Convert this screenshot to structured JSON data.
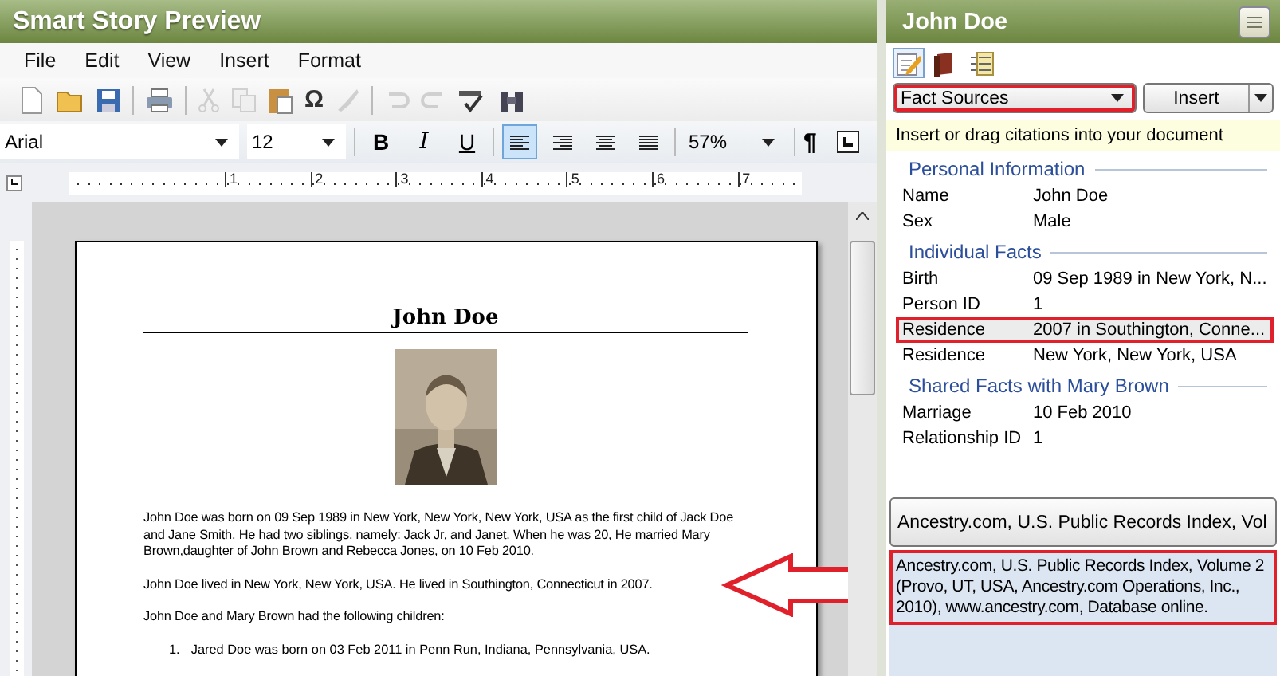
{
  "window": {
    "title": "Smart Story Preview"
  },
  "menu": [
    {
      "label": "File"
    },
    {
      "label": "Edit"
    },
    {
      "label": "View"
    },
    {
      "label": "Insert"
    },
    {
      "label": "Format"
    }
  ],
  "toolbar": [
    {
      "kind": "new",
      "disabled": false
    },
    {
      "kind": "open",
      "disabled": false
    },
    {
      "kind": "save",
      "disabled": false
    },
    {
      "kind": "sep"
    },
    {
      "kind": "print",
      "disabled": false
    },
    {
      "kind": "sep"
    },
    {
      "kind": "cut",
      "disabled": true
    },
    {
      "kind": "copy",
      "disabled": true
    },
    {
      "kind": "paste",
      "disabled": false
    },
    {
      "kind": "symbol",
      "glyph": "Ω",
      "disabled": false
    },
    {
      "kind": "painter",
      "disabled": true
    },
    {
      "kind": "sep"
    },
    {
      "kind": "undo",
      "disabled": true
    },
    {
      "kind": "redo",
      "disabled": true
    },
    {
      "kind": "spell",
      "disabled": false
    },
    {
      "kind": "find",
      "disabled": false
    }
  ],
  "format_bar": {
    "font": "Arial",
    "size": "12",
    "styles": [
      {
        "label": "B",
        "kind": "bold"
      },
      {
        "label": "I",
        "kind": "italic"
      },
      {
        "label": "U",
        "kind": "underline"
      }
    ],
    "alignments": [
      {
        "kind": "left",
        "selected": true
      },
      {
        "kind": "right",
        "selected": false
      },
      {
        "kind": "center",
        "selected": false
      },
      {
        "kind": "justify",
        "selected": false
      }
    ],
    "zoom": "57%",
    "pilcrow": "¶"
  },
  "ruler": {
    "labels": [
      "1",
      "2",
      "3",
      "4",
      "5",
      "6",
      "7"
    ]
  },
  "document": {
    "heading": "John Doe",
    "paragraphs": [
      {
        "text": "John Doe was born on 09 Sep 1989 in New York, New York, New York, USA as the first child of Jack Doe and Jane Smith. He had two siblings, namely: Jack Jr, and Janet. When he was 20, He married Mary Brown,daughter of John Brown and Rebecca Jones, on 10 Feb 2010.",
        "marked": false
      },
      {
        "text": "John Doe lived in New York, New York, USA. He lived in Southington, Connecticut in 2007.",
        "marked": true
      },
      {
        "text": "John Doe and Mary Brown had the following children:",
        "marked": false
      }
    ],
    "list": [
      {
        "number": "1.",
        "text": "Jared Doe was born on 03 Feb 2011 in Penn Run, Indiana, Pennsylvania, USA."
      }
    ]
  },
  "panel": {
    "title": "John Doe",
    "tabs": [
      {
        "kind": "edit",
        "selected": true
      },
      {
        "kind": "book",
        "selected": false
      },
      {
        "kind": "list",
        "selected": false
      }
    ],
    "source_dropdown": {
      "value": "Fact Sources",
      "highlighted": true
    },
    "insert_button": "Insert",
    "hint": "Insert or drag citations into your document",
    "sections": [
      {
        "title": "Personal Information",
        "rows": [
          {
            "label": "Name",
            "value": "John Doe",
            "selected": false,
            "highlighted": false
          },
          {
            "label": "Sex",
            "value": "Male",
            "selected": false,
            "highlighted": false
          }
        ]
      },
      {
        "title": "Individual Facts",
        "rows": [
          {
            "label": "Birth",
            "value": "09 Sep 1989 in New York, N...",
            "selected": false,
            "highlighted": false
          },
          {
            "label": "Person ID",
            "value": "1",
            "selected": false,
            "highlighted": false
          },
          {
            "label": "Residence",
            "value": "2007 in Southington, Conne...",
            "selected": true,
            "highlighted": true
          },
          {
            "label": "Residence",
            "value": "New York, New York, USA",
            "selected": false,
            "highlighted": false
          }
        ]
      },
      {
        "title": "Shared Facts with Mary Brown",
        "rows": [
          {
            "label": "Marriage",
            "value": "10 Feb 2010",
            "selected": false,
            "highlighted": false
          },
          {
            "label": "Relationship ID",
            "value": "1",
            "selected": false,
            "highlighted": false
          }
        ]
      }
    ],
    "citation_dropdown": "Ancestry.com, U.S. Public Records Index, Vol",
    "citation": {
      "text": "Ancestry.com, U.S. Public Records Index, Volume 2 (Provo, UT, USA, Ancestry.com Operations, Inc., 2010), www.ancestry.com, Database online.",
      "highlighted": true
    }
  }
}
